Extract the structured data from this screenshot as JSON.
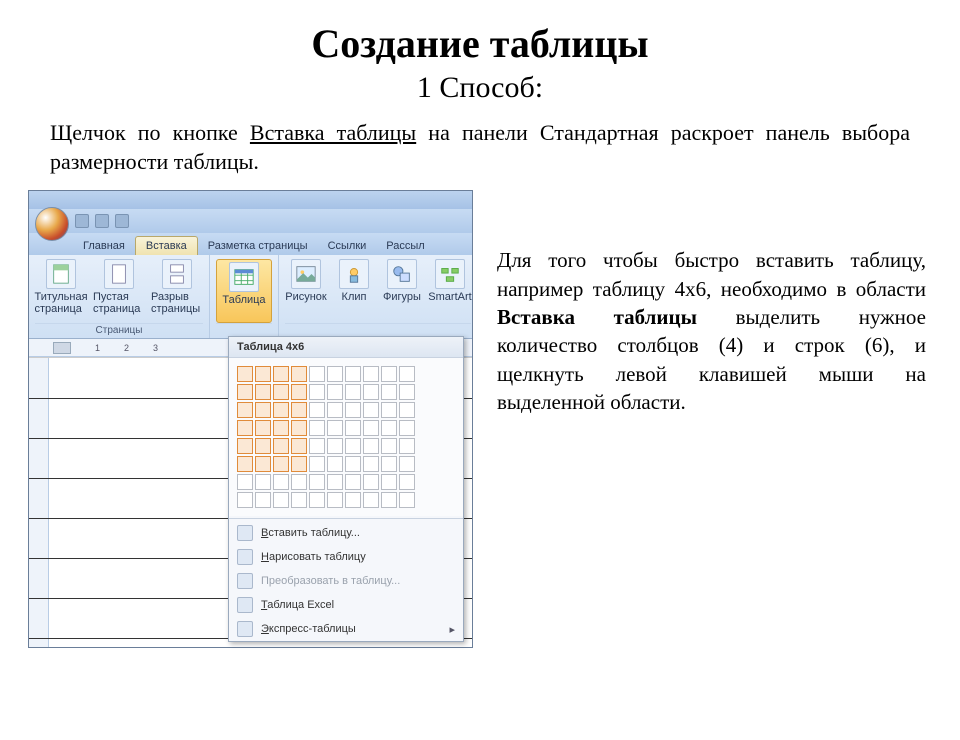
{
  "page": {
    "title": "Создание таблицы",
    "subtitle": "1 Способ:",
    "intro_pre": "Щелчок по кнопке ",
    "intro_under": "Вставка таблицы",
    "intro_post": " на панели Стандартная раскроет панель выбора размерности таблицы.",
    "side_pre": "Для того чтобы быстро вставить таблицу, например таблицу 4х6, необходимо в области ",
    "side_bold": "Вставка таблицы",
    "side_post": " выделить нужное количество столбцов (4) и строк (6), и щелкнуть левой клавишей мыши на выделенной области."
  },
  "word": {
    "tabs": [
      "Главная",
      "Вставка",
      "Разметка страницы",
      "Ссылки",
      "Рассыл"
    ],
    "active_tab": 1,
    "group_pages": "Страницы",
    "items": {
      "cover_page": "Титульная страница",
      "blank_page": "Пустая страница",
      "page_break": "Разрыв страницы",
      "table": "Таблица",
      "picture": "Рисунок",
      "clip": "Клип",
      "shapes": "Фигуры",
      "smartart": "SmartArt"
    },
    "ruler": [
      "1",
      "2",
      "3"
    ]
  },
  "dropdown": {
    "title": "Таблица 4x6",
    "cols": 10,
    "rows": 8,
    "sel_cols": 4,
    "sel_rows": 6,
    "menu": {
      "insert": "Вставить таблицу...",
      "draw": "Нарисовать таблицу",
      "convert": "Преобразовать в таблицу...",
      "excel": "Таблица Excel",
      "quick": "Экспресс-таблицы"
    }
  }
}
